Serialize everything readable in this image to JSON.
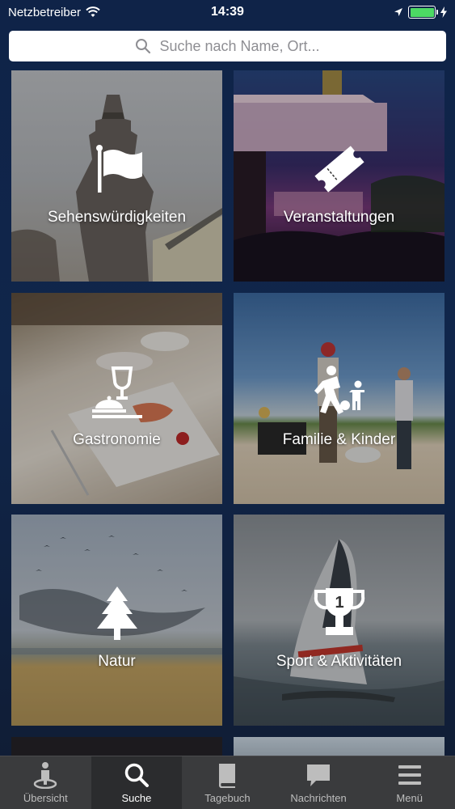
{
  "status_bar": {
    "carrier": "Netzbetreiber",
    "time": "14:39",
    "battery_level": 1.0,
    "icons": [
      "wifi-icon",
      "location-arrow-icon",
      "battery-icon",
      "charging-icon"
    ]
  },
  "search": {
    "placeholder": "Suche nach Name, Ort..."
  },
  "categories": [
    {
      "label": "Sehenswürdigkeiten",
      "icon": "flag-icon"
    },
    {
      "label": "Veranstaltungen",
      "icon": "ticket-icon"
    },
    {
      "label": "Gastronomie",
      "icon": "dining-icon"
    },
    {
      "label": "Familie & Kinder",
      "icon": "family-icon"
    },
    {
      "label": "Natur",
      "icon": "tree-icon"
    },
    {
      "label": "Sport & Aktivitäten",
      "icon": "trophy-icon"
    }
  ],
  "tab_bar": {
    "tabs": [
      {
        "label": "Übersicht",
        "icon": "map-pin-person-icon",
        "active": false
      },
      {
        "label": "Suche",
        "icon": "search-icon",
        "active": true
      },
      {
        "label": "Tagebuch",
        "icon": "book-icon",
        "active": false
      },
      {
        "label": "Nachrichten",
        "icon": "chat-bubble-icon",
        "active": false
      },
      {
        "label": "Menü",
        "icon": "hamburger-menu-icon",
        "active": false
      }
    ]
  },
  "colors": {
    "background": "#10264b",
    "tab_bar": "#3a3b3d",
    "tab_active": "#2b2c2e",
    "battery": "#4cd964"
  }
}
